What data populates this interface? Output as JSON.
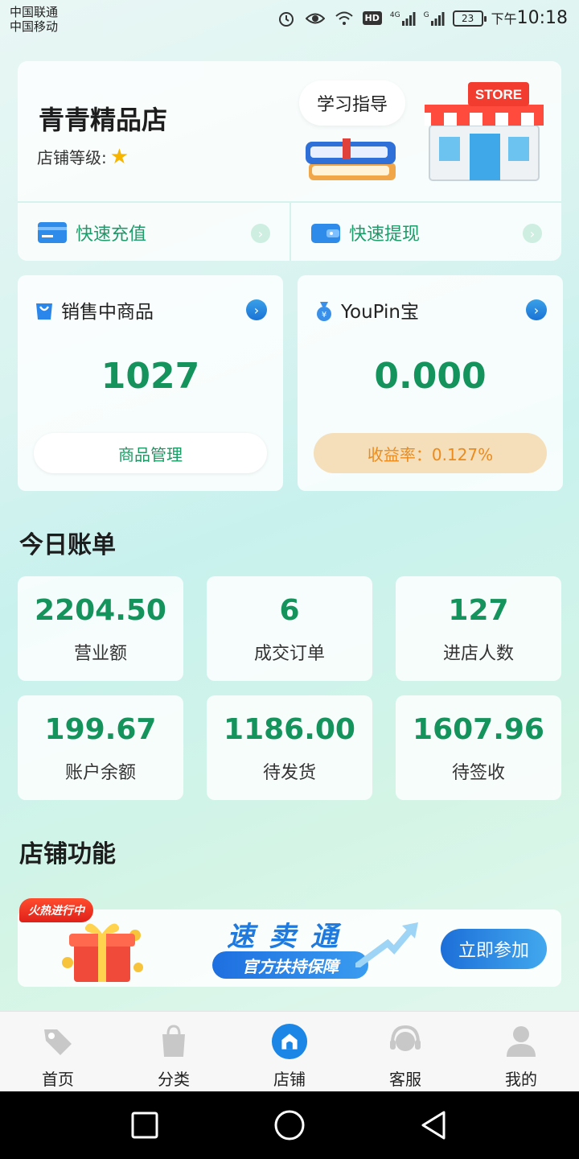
{
  "status_bar": {
    "carrier1": "中国联通",
    "carrier2": "中国移动",
    "hd": "HD",
    "net1": "4G",
    "net2": "G",
    "battery": "23",
    "ampm": "下午",
    "time": "10:18"
  },
  "shop": {
    "name": "青青精品店",
    "level_label": "店铺等级:",
    "level_stars": 1,
    "guide_label": "学习指导",
    "store_sign": "STORE",
    "quick_recharge": "快速充值",
    "quick_withdraw": "快速提现"
  },
  "products": {
    "title": "销售中商品",
    "value": "1027",
    "button": "商品管理"
  },
  "youpin": {
    "title": "YouPin宝",
    "value": "0.000",
    "rate": "收益率：0.127%"
  },
  "bill": {
    "title": "今日账单",
    "stats": [
      {
        "value": "2204.50",
        "label": "营业额"
      },
      {
        "value": "6",
        "label": "成交订单"
      },
      {
        "value": "127",
        "label": "进店人数"
      },
      {
        "value": "199.67",
        "label": "账户余额"
      },
      {
        "value": "1186.00",
        "label": "待发货"
      },
      {
        "value": "1607.96",
        "label": "待签收"
      }
    ]
  },
  "functions": {
    "title": "店铺功能",
    "banner_tag": "火热进行中",
    "banner_title": "速卖通",
    "banner_sub": "官方扶持保障",
    "banner_button": "立即参加"
  },
  "tabbar": {
    "items": [
      {
        "label": "首页",
        "icon": "tag-icon",
        "active": false
      },
      {
        "label": "分类",
        "icon": "shopping-bag-icon",
        "active": false
      },
      {
        "label": "店铺",
        "icon": "store-icon",
        "active": true
      },
      {
        "label": "客服",
        "icon": "headset-icon",
        "active": false
      },
      {
        "label": "我的",
        "icon": "user-icon",
        "active": false
      }
    ]
  },
  "colors": {
    "accent_green": "#14935c",
    "accent_blue": "#1f7ae0",
    "rate_orange": "#ec8b1c"
  }
}
